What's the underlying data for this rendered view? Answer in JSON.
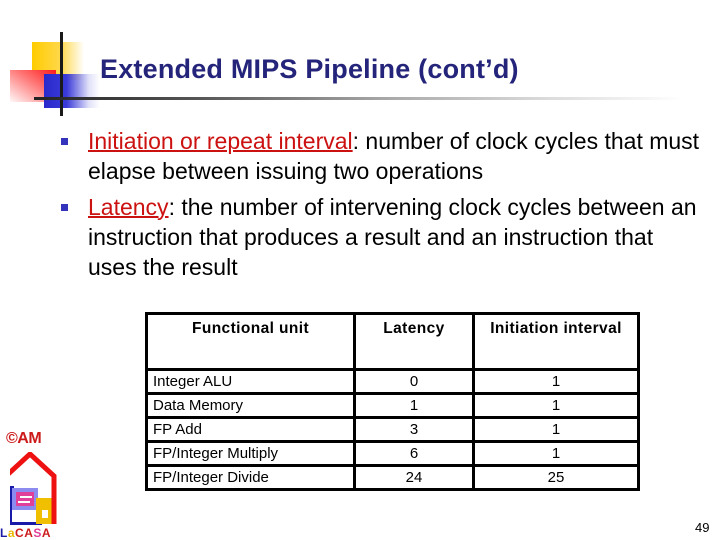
{
  "slide": {
    "title": "Extended MIPS Pipeline (cont’d)",
    "page_number": "49",
    "colors": {
      "title": "#24247a",
      "term": "#cc1111",
      "bullet": "#3333bb"
    }
  },
  "bullets": [
    {
      "term": "Initiation or repeat interval",
      "text": ": number of clock cycles that must elapse between issuing two operations"
    },
    {
      "term": "Latency",
      "text": ": the number of intervening clock cycles between an instruction that produces a result and an instruction that uses the result"
    }
  ],
  "table": {
    "headers": [
      "Functional unit",
      "Latency",
      "Initiation interval"
    ],
    "rows": [
      [
        "Integer ALU",
        "0",
        "1"
      ],
      [
        "Data Memory",
        "1",
        "1"
      ],
      [
        "FP Add",
        "3",
        "1"
      ],
      [
        "FP/Integer Multiply",
        "6",
        "1"
      ],
      [
        "FP/Integer Divide",
        "24",
        "25"
      ]
    ]
  },
  "logo": {
    "copyright_mark": "©AM",
    "name_letters": [
      {
        "ch": "L",
        "color": "#1a1aa8"
      },
      {
        "ch": "a",
        "color": "#e8b800"
      },
      {
        "ch": "C",
        "color": "#cc1a1a"
      },
      {
        "ch": "A",
        "color": "#cc1a1a"
      },
      {
        "ch": "S",
        "color": "#e0409a"
      },
      {
        "ch": "A",
        "color": "#cc1a1a"
      }
    ]
  }
}
